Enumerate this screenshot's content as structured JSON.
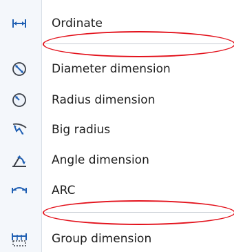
{
  "menu": {
    "items": [
      {
        "label": "Ordinate",
        "icon": "ordinate-dimension-icon"
      },
      {
        "label": "Diameter dimension",
        "icon": "diameter-dimension-icon"
      },
      {
        "label": "Radius dimension",
        "icon": "radius-dimension-icon"
      },
      {
        "label": "Big radius",
        "icon": "big-radius-icon"
      },
      {
        "label": "Angle dimension",
        "icon": "angle-dimension-icon"
      },
      {
        "label": "ARC",
        "icon": "arc-dimension-icon"
      },
      {
        "label": "Group dimension",
        "icon": "group-dimension-icon"
      }
    ]
  },
  "colors": {
    "icon_blue": "#1f5fb3",
    "highlight_red": "#e3121c",
    "text": "#1e1e1e",
    "gutter": "#f4f7fb"
  }
}
